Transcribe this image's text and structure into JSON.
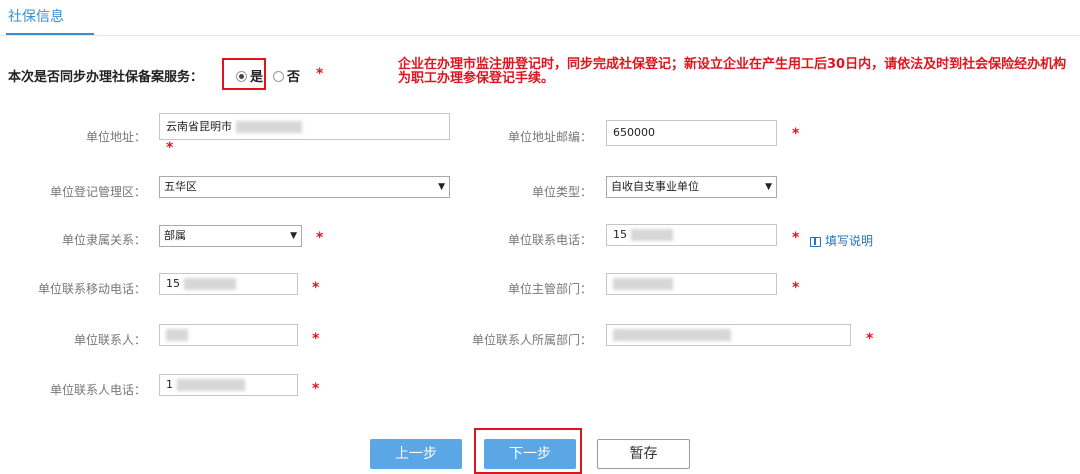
{
  "tab": {
    "title": "社保信息"
  },
  "sync": {
    "label": "本次是否同步办理社保备案服务：",
    "yes": "是",
    "no": "否",
    "required": "*",
    "notice": "企业在办理市监注册登记时，同步完成社保登记；新设立企业在产生用工后30日内，请依法及时到社会保险经办机构为职工办理参保登记手续。"
  },
  "form": {
    "address_label": "单位地址：",
    "address_value": "云南省昆明市",
    "postal_label": "单位地址邮编：",
    "postal_value": "650000",
    "district_label": "单位登记管理区：",
    "district_value": "五华区",
    "type_label": "单位类型：",
    "type_value": "自收自支事业单位",
    "affiliation_label": "单位隶属关系：",
    "affiliation_value": "部属",
    "phone_label": "单位联系电话：",
    "phone_value": "15",
    "help_link": "填写说明",
    "mobile_label": "单位联系移动电话：",
    "mobile_value": "15",
    "dept_label": "单位主管部门：",
    "contact_label": "单位联系人：",
    "contact_dept_label": "单位联系人所属部门：",
    "contact_phone_label": "单位联系人电话：",
    "contact_phone_value": "1",
    "required": "*"
  },
  "buttons": {
    "prev": "上一步",
    "next": "下一步",
    "save": "暂存"
  },
  "colors": {
    "accent": "#3b8fd1",
    "required": "#e0141e",
    "button_primary": "#5ba7e6",
    "link": "#2473c2"
  }
}
